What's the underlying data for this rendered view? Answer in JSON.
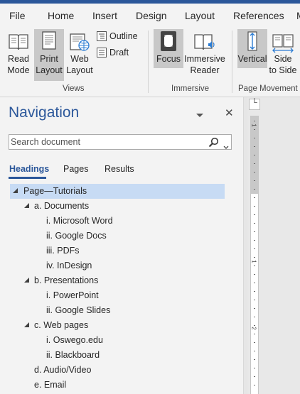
{
  "ribbon_tabs": [
    "File",
    "Home",
    "Insert",
    "Design",
    "Layout",
    "References",
    "M"
  ],
  "views_group": {
    "label": "Views",
    "read_mode": [
      "Read",
      "Mode"
    ],
    "print_layout": [
      "Print",
      "Layout"
    ],
    "web_layout": [
      "Web",
      "Layout"
    ],
    "outline": "Outline",
    "draft": "Draft"
  },
  "immersive_group": {
    "label": "Immersive",
    "focus": "Focus",
    "immersive_reader": [
      "Immersive",
      "Reader"
    ]
  },
  "page_movement_group": {
    "label": "Page Movement",
    "vertical": "Vertical",
    "side_to_side": [
      "Side",
      "to Side"
    ]
  },
  "navigation": {
    "title": "Navigation",
    "close_glyph": "✕",
    "search_placeholder": "Search document",
    "tabs": [
      "Headings",
      "Pages",
      "Results"
    ],
    "tree": [
      {
        "label": "Page—Tutorials",
        "level": 0,
        "expanded": true,
        "selected": true
      },
      {
        "label": "a. Documents",
        "level": 1,
        "expanded": true
      },
      {
        "label": "i. Microsoft Word",
        "level": 2
      },
      {
        "label": "ii. Google Docs",
        "level": 2
      },
      {
        "label": "iii. PDFs",
        "level": 2
      },
      {
        "label": "iv. InDesign",
        "level": 2
      },
      {
        "label": "b. Presentations",
        "level": 1,
        "expanded": true
      },
      {
        "label": "i. PowerPoint",
        "level": 2
      },
      {
        "label": "ii. Google Slides",
        "level": 2
      },
      {
        "label": "c. Web pages",
        "level": 1,
        "expanded": true
      },
      {
        "label": "i. Oswego.edu",
        "level": 2
      },
      {
        "label": "ii. Blackboard",
        "level": 2
      },
      {
        "label": "d. Audio/Video",
        "level": 1
      },
      {
        "label": "e. Email",
        "level": 1
      }
    ]
  },
  "ruler": {
    "tab_glyph": "└",
    "numbers": [
      "1",
      "1",
      "2"
    ]
  },
  "colors": {
    "accent": "#2b579a",
    "selected_row": "#c7dbf4",
    "pressed_button": "#c8c8c8"
  }
}
